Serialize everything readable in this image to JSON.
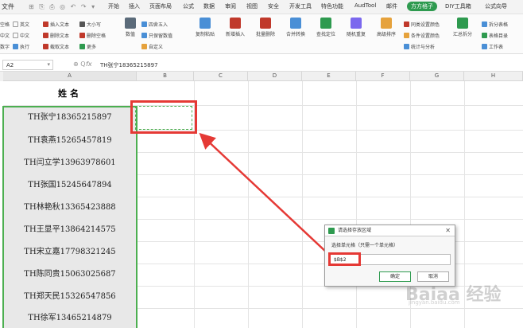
{
  "menubar": {
    "file": "文件",
    "quick_access_icons": "⊞ ⎘ ⎙ ◎ ↶ ↷ ▾",
    "tabs": [
      "开始",
      "插入",
      "页面布局",
      "公式",
      "数据",
      "审阅",
      "视图",
      "安全",
      "开发工具",
      "特色功能",
      "AudTool",
      "邮件",
      "方方格子",
      "DIY工具箱",
      "公式向导"
    ],
    "active_tab": "方方格子"
  },
  "ribbon": {
    "left_groups": [
      {
        "rows": [
          "空格",
          "中文",
          "数字"
        ]
      },
      {
        "rows": [
          "英文",
          "中文",
          "执行"
        ]
      },
      {
        "rows": [
          "插入文本",
          "删除文本",
          "截取文本"
        ]
      },
      {
        "rows": [
          "大小写",
          "删除空格",
          "更多"
        ]
      },
      {
        "rows": [
          "数值"
        ]
      },
      {
        "rows": [
          "四舍五入",
          "只保留数值",
          "自定义"
        ]
      }
    ],
    "big_buttons": [
      "复制粘贴",
      "新增插入",
      "批量删除",
      "合并转换",
      "查找定位",
      "随机重复",
      "高级排序",
      "汇总拆分",
      "工作表"
    ],
    "right_rows": [
      "同类设置颜色",
      "条件设置颜色",
      "统计与分析",
      "拆分表格",
      "表格目录"
    ]
  },
  "formula_bar": {
    "name_box": "A2",
    "icons": "⊕ Q",
    "fx": "fx",
    "value": "TH张宁18365215897"
  },
  "columns": [
    "A",
    "B",
    "C",
    "D",
    "E",
    "F",
    "G",
    "H"
  ],
  "header_cell": "姓名",
  "names": [
    "TH张宁18365215897",
    "TH袁燕15265457819",
    "TH闫立学13963978601",
    "TH张国15245647894",
    "TH林艳秋13365423888",
    "TH王显平13864214575",
    "TH宋立嘉17798321245",
    "TH陈同贵15063025687",
    "TH郑天民15326547856",
    "TH徐军13465214879"
  ],
  "dialog": {
    "title": "请选择存放区域",
    "label": "选择单元格（只需一个单元格）",
    "value": "$B$2",
    "ok": "确定",
    "cancel": "取消",
    "close": "✕"
  },
  "watermark": {
    "main": "Baiaa 经验",
    "sub": "jingyan.baidu.com"
  },
  "colors": {
    "accent": "#2e9a4f",
    "highlight": "#e53935",
    "selection": "#4caf50"
  }
}
